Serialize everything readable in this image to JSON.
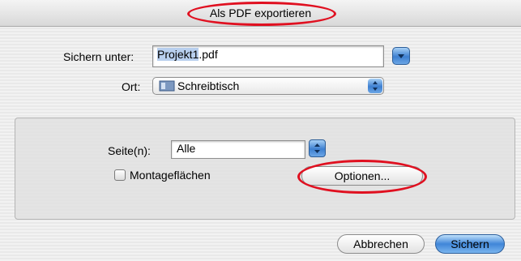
{
  "dialog": {
    "title": "Als PDF exportieren"
  },
  "save_as": {
    "label": "Sichern unter:",
    "filename_selected": "Projekt1",
    "filename_ext": ".pdf"
  },
  "location": {
    "label": "Ort:",
    "value": "Schreibtisch"
  },
  "pages": {
    "label": "Seite(n):",
    "value": "Alle"
  },
  "options": {
    "checkbox_label": "Montageflächen",
    "checked": false,
    "button_label": "Optionen..."
  },
  "footer": {
    "cancel_label": "Abbrechen",
    "save_label": "Sichern"
  },
  "colors": {
    "annotation": "#e01020",
    "accent": "#3d7fd0"
  }
}
